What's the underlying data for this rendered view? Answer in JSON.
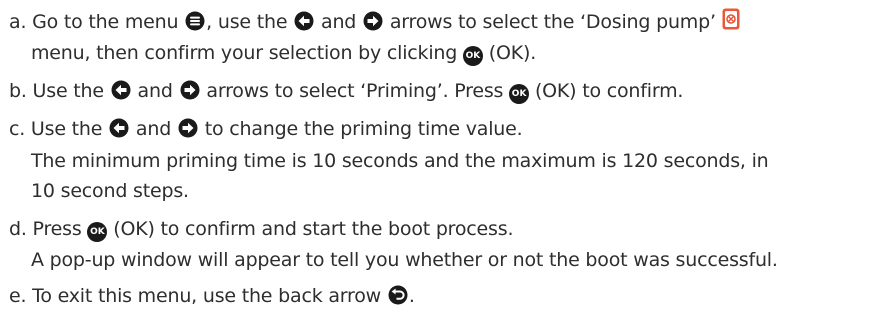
{
  "colors": {
    "text": "#2e2e2e",
    "icon": "#1a1a1a",
    "pump_icon": "#e8583a"
  },
  "icons": {
    "menu": "menu-circle-icon",
    "left": "left-arrow-circle-icon",
    "right": "right-arrow-circle-icon",
    "ok": "ok-button-icon",
    "pump": "dosing-pump-icon",
    "back": "back-arrow-circle-icon"
  },
  "ok_label": "OK",
  "steps": {
    "a": {
      "t1": "a.  Go to the menu ",
      "t2": ", use the ",
      "t3": " and ",
      "t4": " arrows to select the ‘Dosing pump’ ",
      "t5": "menu, then confirm your selection by clicking ",
      "t6": " (OK)."
    },
    "b": {
      "t1": "b.  Use the ",
      "t2": " and ",
      "t3": " arrows to select ‘Priming’. Press ",
      "t4": " (OK) to confirm."
    },
    "c": {
      "t1": "c.  Use the ",
      "t2": " and ",
      "t3": " to change the priming time value.",
      "t4": "The minimum priming time is 10 seconds and the maximum is 120 seconds, in",
      "t5": "10 second steps."
    },
    "d": {
      "t1": "d.  Press ",
      "t2": " (OK) to confirm and start the boot process.",
      "t3": "A pop-up window will appear to tell you whether or not the boot was successful."
    },
    "e": {
      "t1": "e.  To exit this menu, use the back arrow ",
      "t2": "."
    }
  }
}
